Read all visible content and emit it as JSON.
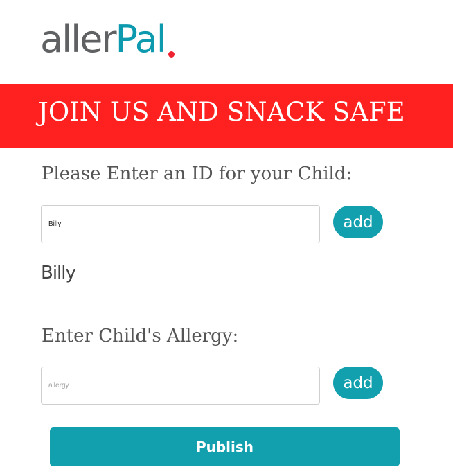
{
  "brand": {
    "logo_part_a": "aller",
    "logo_part_b": "Pal",
    "colors": {
      "grey": "#5f6163",
      "teal": "#0e9aae",
      "dot": "#ee2230"
    }
  },
  "banner": {
    "text": "JOIN US AND SNACK SAFE",
    "background": "#ff2020"
  },
  "child_id_section": {
    "label": "Please Enter an ID for your Child:",
    "input_value": "Billy",
    "add_label": "add"
  },
  "added_child": {
    "name": "Billy"
  },
  "allergy_section": {
    "label": "Enter Child's Allergy:",
    "input_placeholder": "allergy",
    "input_value": "",
    "add_label": "add"
  },
  "publish": {
    "label": "Publish"
  },
  "accent_color": "#12a0ae"
}
